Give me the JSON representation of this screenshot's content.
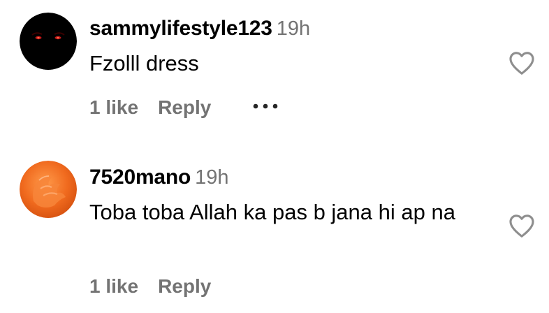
{
  "comments": [
    {
      "username": "sammylifestyle123",
      "time": "19h",
      "text": "Fzolll dress",
      "likes": "1 like",
      "reply_label": "Reply",
      "avatar": "dark-avatar-with-red-eyes"
    },
    {
      "username": "7520mano",
      "time": "19h",
      "text": "Toba toba Allah ka pas b jana hi ap na",
      "likes": "1 like",
      "reply_label": "Reply",
      "avatar": "orange-hand-avatar"
    }
  ],
  "icons": {
    "like": "heart-outline-icon",
    "more": "more-options-icon"
  },
  "colors": {
    "text": "#000000",
    "secondary": "#737373",
    "icon": "#8e8e8e"
  }
}
